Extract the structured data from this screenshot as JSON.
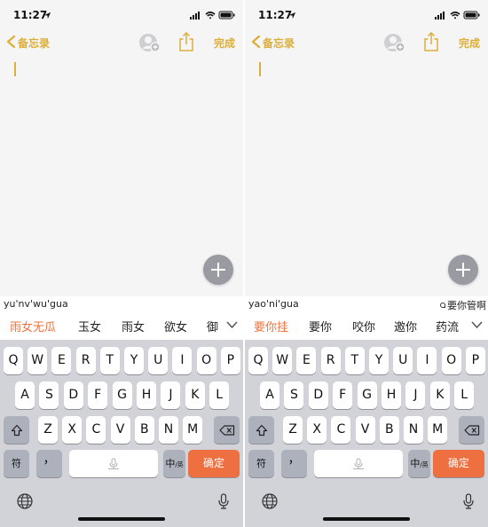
{
  "screens": [
    {
      "status": {
        "time": "11:27"
      },
      "nav": {
        "back_label": "备忘录",
        "done_label": "完成"
      },
      "ime": {
        "composition": "yu'nv'wu'gua",
        "composition_suggestion": "",
        "candidates": [
          "雨女无瓜",
          "玉女",
          "雨女",
          "欲女",
          "御"
        ]
      }
    },
    {
      "status": {
        "time": "11:27"
      },
      "nav": {
        "back_label": "备忘录",
        "done_label": "完成"
      },
      "ime": {
        "composition": "yao'ni'gua",
        "composition_suggestion": "要你管啊",
        "candidates": [
          "要你挂",
          "要你",
          "咬你",
          "邀你",
          "药流"
        ]
      }
    }
  ],
  "keyboard": {
    "row1": [
      "Q",
      "W",
      "E",
      "R",
      "T",
      "Y",
      "U",
      "I",
      "O",
      "P"
    ],
    "row2": [
      "A",
      "S",
      "D",
      "F",
      "G",
      "H",
      "J",
      "K",
      "L"
    ],
    "row3": [
      "Z",
      "X",
      "C",
      "V",
      "B",
      "N",
      "M"
    ],
    "symbol_key": "符",
    "punct_key": "，",
    "lang_key": "中",
    "lang_sub": "/英",
    "enter_key": "确定"
  },
  "colors": {
    "accent": "#dcae3b",
    "enter": "#ee6f3f",
    "candidate_selected": "#ef7240"
  },
  "icons": {
    "location": "location-arrow-icon",
    "signal": "signal-icon",
    "wifi": "wifi-icon",
    "battery": "battery-icon",
    "back": "chevron-left-icon",
    "collab": "add-person-icon",
    "share": "share-icon",
    "add": "plus-icon",
    "shift": "shift-icon",
    "delete": "backspace-icon",
    "mic": "microphone-icon",
    "globe": "globe-icon",
    "expand": "chevron-down-icon"
  }
}
